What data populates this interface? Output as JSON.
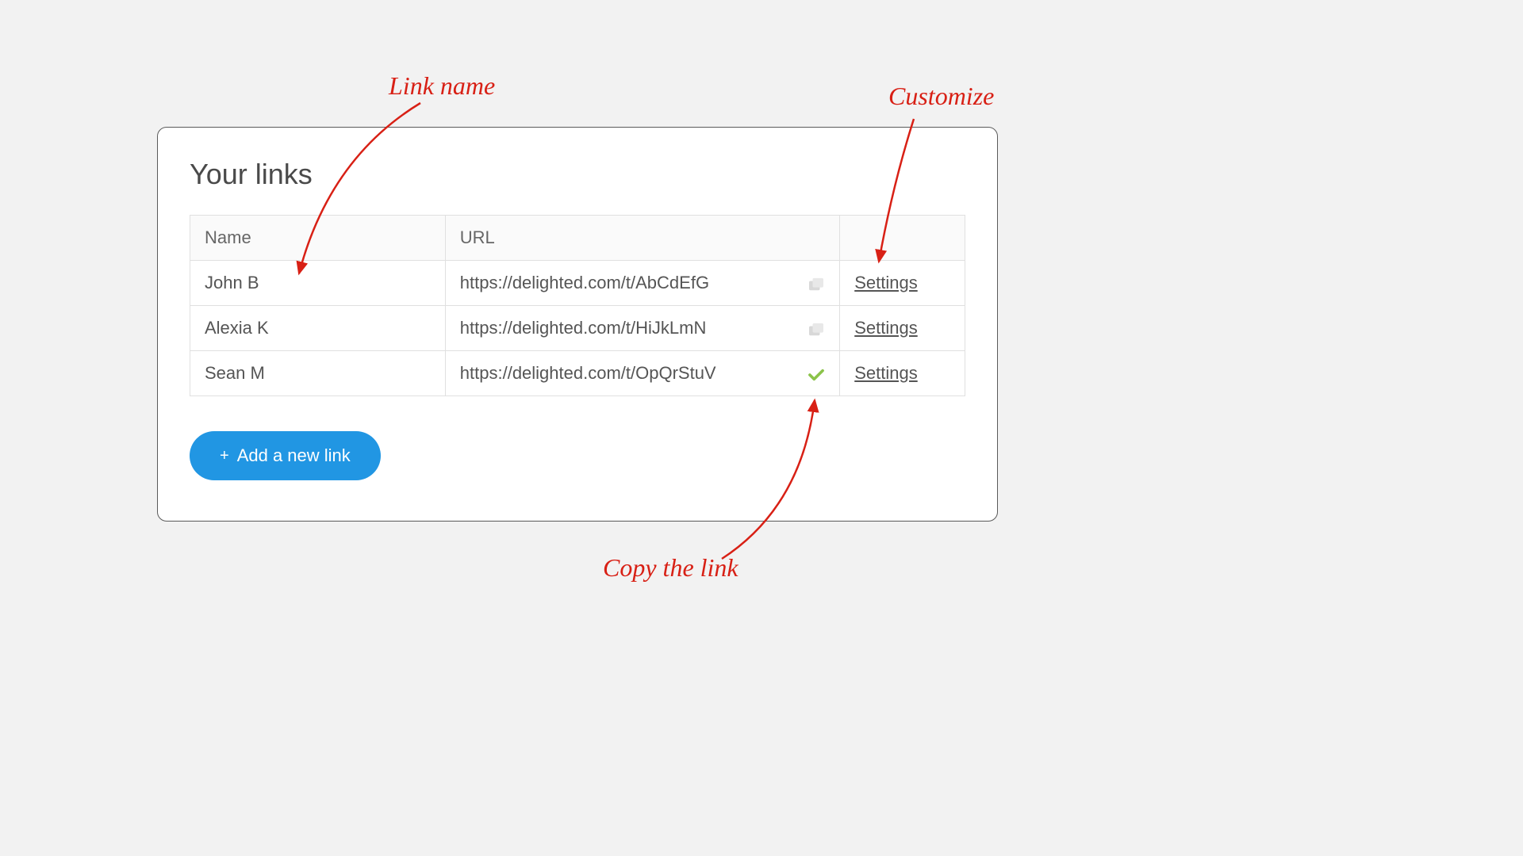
{
  "panel": {
    "title": "Your links"
  },
  "table": {
    "headers": {
      "name": "Name",
      "url": "URL"
    },
    "rows": [
      {
        "name": "John B",
        "url": "https://delighted.com/t/AbCdEfG",
        "copied": false,
        "settings_label": "Settings"
      },
      {
        "name": "Alexia K",
        "url": "https://delighted.com/t/HiJkLmN",
        "copied": false,
        "settings_label": "Settings"
      },
      {
        "name": "Sean M",
        "url": "https://delighted.com/t/OpQrStuV",
        "copied": true,
        "settings_label": "Settings"
      }
    ]
  },
  "add_button_label": "Add a new link",
  "annotations": {
    "link_name": "Link name",
    "customize": "Customize",
    "copy_link": "Copy the link"
  },
  "colors": {
    "annotation": "#d82015",
    "button": "#2196e3",
    "check": "#8bc34a",
    "copy_icon": "#d8d8d8"
  }
}
